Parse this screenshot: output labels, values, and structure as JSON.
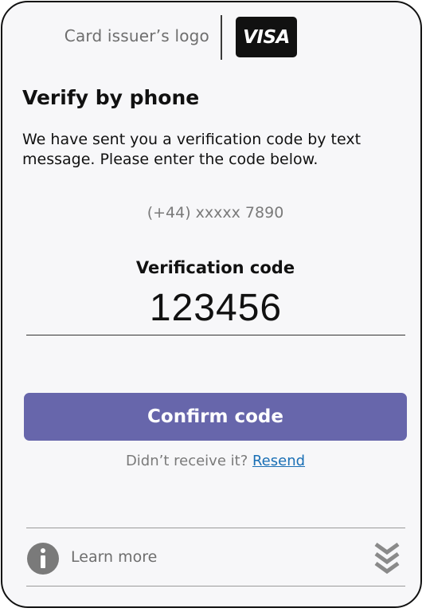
{
  "header": {
    "issuer_logo_text": "Card issuer’s logo",
    "card_brand": "VISA"
  },
  "main": {
    "title": "Verify by phone",
    "message": "We have sent you a verification code by text message. Please enter the code below.",
    "phone_number": "(+44) xxxxx 7890",
    "code_label": "Verification code",
    "code_value": "123456",
    "confirm_label": "Confirm code",
    "resend_prompt": "Didn’t receive it?",
    "resend_link": "Resend"
  },
  "footer": {
    "learn_more_label": "Learn more",
    "info_icon": "info-icon",
    "expand_icon": "chevron-double-down-icon"
  },
  "colors": {
    "accent": "#6766ab",
    "link": "#1a6fb5",
    "muted_text": "#7a7a7a",
    "background": "#f7f7f9"
  }
}
